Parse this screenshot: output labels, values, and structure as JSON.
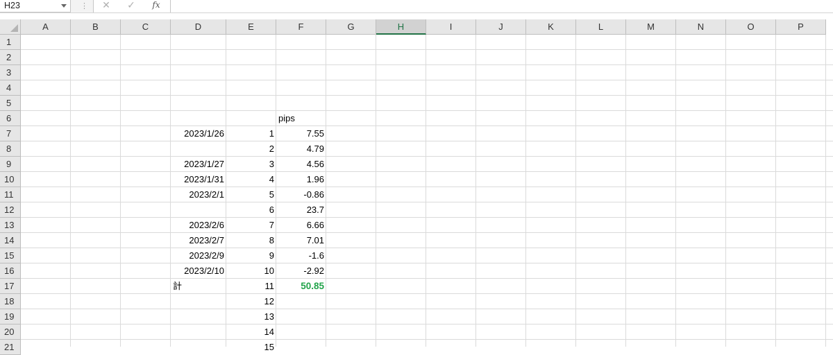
{
  "formula_bar": {
    "name_box": "H23",
    "cancel_icon": "✕",
    "enter_icon": "✓",
    "fx_label": "fx",
    "content": ""
  },
  "columns": [
    "A",
    "B",
    "C",
    "D",
    "E",
    "F",
    "G",
    "H",
    "I",
    "J",
    "K",
    "L",
    "M",
    "N",
    "O",
    "P"
  ],
  "selected_column": "H",
  "rows": [
    "1",
    "2",
    "3",
    "4",
    "5",
    "6",
    "7",
    "8",
    "9",
    "10",
    "11",
    "12",
    "13",
    "14",
    "15",
    "16",
    "17",
    "18",
    "19",
    "20",
    "21"
  ],
  "cells": {
    "F6": "pips",
    "D7": "2023/1/26",
    "E7": "1",
    "F7": "7.55",
    "E8": "2",
    "F8": "4.79",
    "D9": "2023/1/27",
    "E9": "3",
    "F9": "4.56",
    "D10": "2023/1/31",
    "E10": "4",
    "F10": "1.96",
    "D11": "2023/2/1",
    "E11": "5",
    "F11": "-0.86",
    "E12": "6",
    "F12": "23.7",
    "D13": "2023/2/6",
    "E13": "7",
    "F13": "6.66",
    "D14": "2023/2/7",
    "E14": "8",
    "F14": "7.01",
    "D15": "2023/2/9",
    "E15": "9",
    "F15": "-1.6",
    "D16": "2023/2/10",
    "E16": "10",
    "F16": "-2.92",
    "D17": "計",
    "E17": "11",
    "F17": "50.85",
    "E18": "12",
    "E19": "13",
    "E20": "14",
    "E21": "15"
  },
  "colors": {
    "total_value": "#22a34a",
    "selected_header": "#217346"
  }
}
